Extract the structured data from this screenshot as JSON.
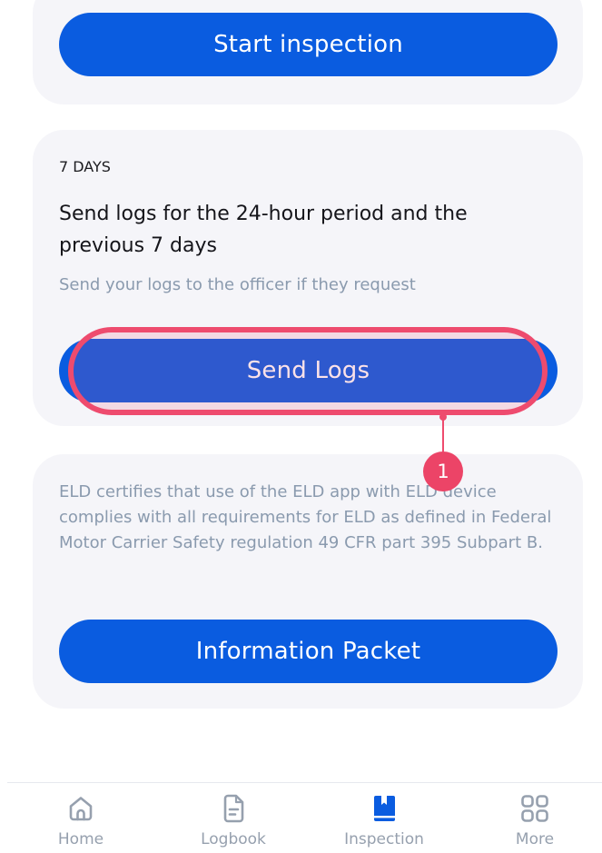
{
  "top_card": {
    "button_label": "Start inspection"
  },
  "days_card": {
    "label": "7 DAYS",
    "title": "Send logs for the 24-hour period and the previous 7 days",
    "subtitle": "Send your logs to the officer if they request",
    "button_label": "Send Logs"
  },
  "info_card": {
    "text": "ELD certifies that use of the ELD app with ELD device complies with all requirements for ELD as defined in Federal Motor Carrier Safety regulation 49 CFR part 395 Subpart B.",
    "button_label": "Information Packet"
  },
  "annotation": {
    "badge": "1"
  },
  "bottom_nav": {
    "items": [
      {
        "label": "Home",
        "icon": "home-icon"
      },
      {
        "label": "Logbook",
        "icon": "document-icon"
      },
      {
        "label": "Inspection",
        "icon": "book-icon"
      },
      {
        "label": "More",
        "icon": "grid-icon"
      }
    ],
    "active": "Inspection"
  },
  "colors": {
    "primary": "#0a5ce0",
    "card_bg": "#f5f5f9",
    "annotation": "#ee4b6e",
    "muted_text": "#8a9aae"
  }
}
